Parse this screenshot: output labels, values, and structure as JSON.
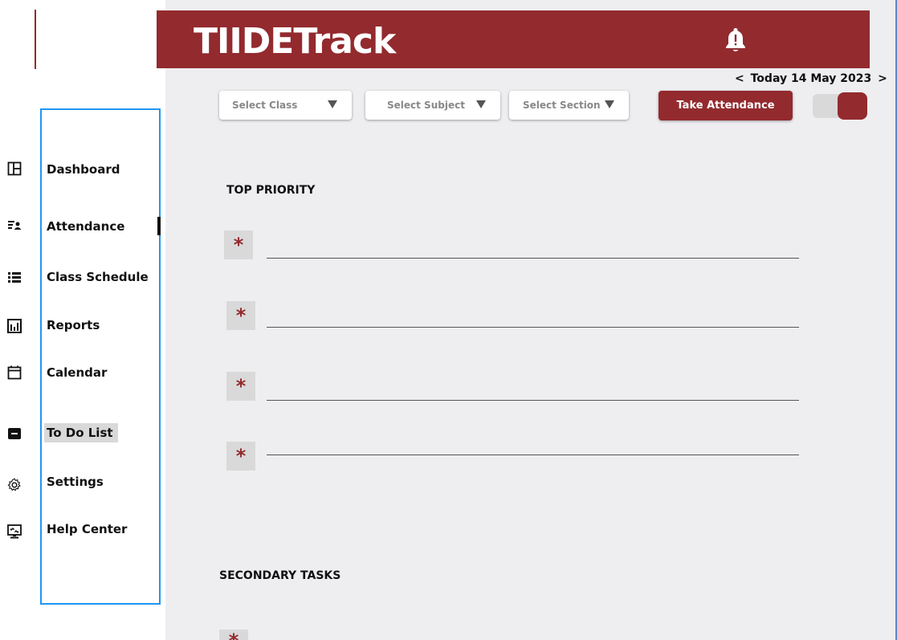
{
  "header": {
    "app_title": "TIIDETrack"
  },
  "date_nav": {
    "prev": "<",
    "label": "Today 14 May 2023",
    "next": ">"
  },
  "filters": {
    "class_label": "Select Class",
    "subject_label": "Select Subject",
    "section_label": "Select Section"
  },
  "take_attendance_label": "Take Attendance",
  "sidebar": {
    "items": [
      {
        "label": "Dashboard",
        "icon": "dashboard-icon"
      },
      {
        "label": "Attendance",
        "icon": "attendance-icon",
        "active": true
      },
      {
        "label": "Class Schedule",
        "icon": "list-icon"
      },
      {
        "label": "Reports",
        "icon": "bar-chart-icon"
      },
      {
        "label": "Calendar",
        "icon": "calendar-icon"
      },
      {
        "label": "To Do List",
        "icon": "todo-icon",
        "selected": true
      },
      {
        "label": "Settings",
        "icon": "gear-icon"
      },
      {
        "label": "Help Center",
        "icon": "help-center-icon"
      }
    ]
  },
  "top_priority": {
    "title": "TOP PRIORITY",
    "task_marker": "*",
    "task_count": 4
  },
  "secondary_tasks": {
    "title": "SECONDARY TASKS"
  },
  "colors": {
    "brand": "#932a2e",
    "content_bg": "#eeeef1",
    "nav_outline": "#2196f3"
  }
}
